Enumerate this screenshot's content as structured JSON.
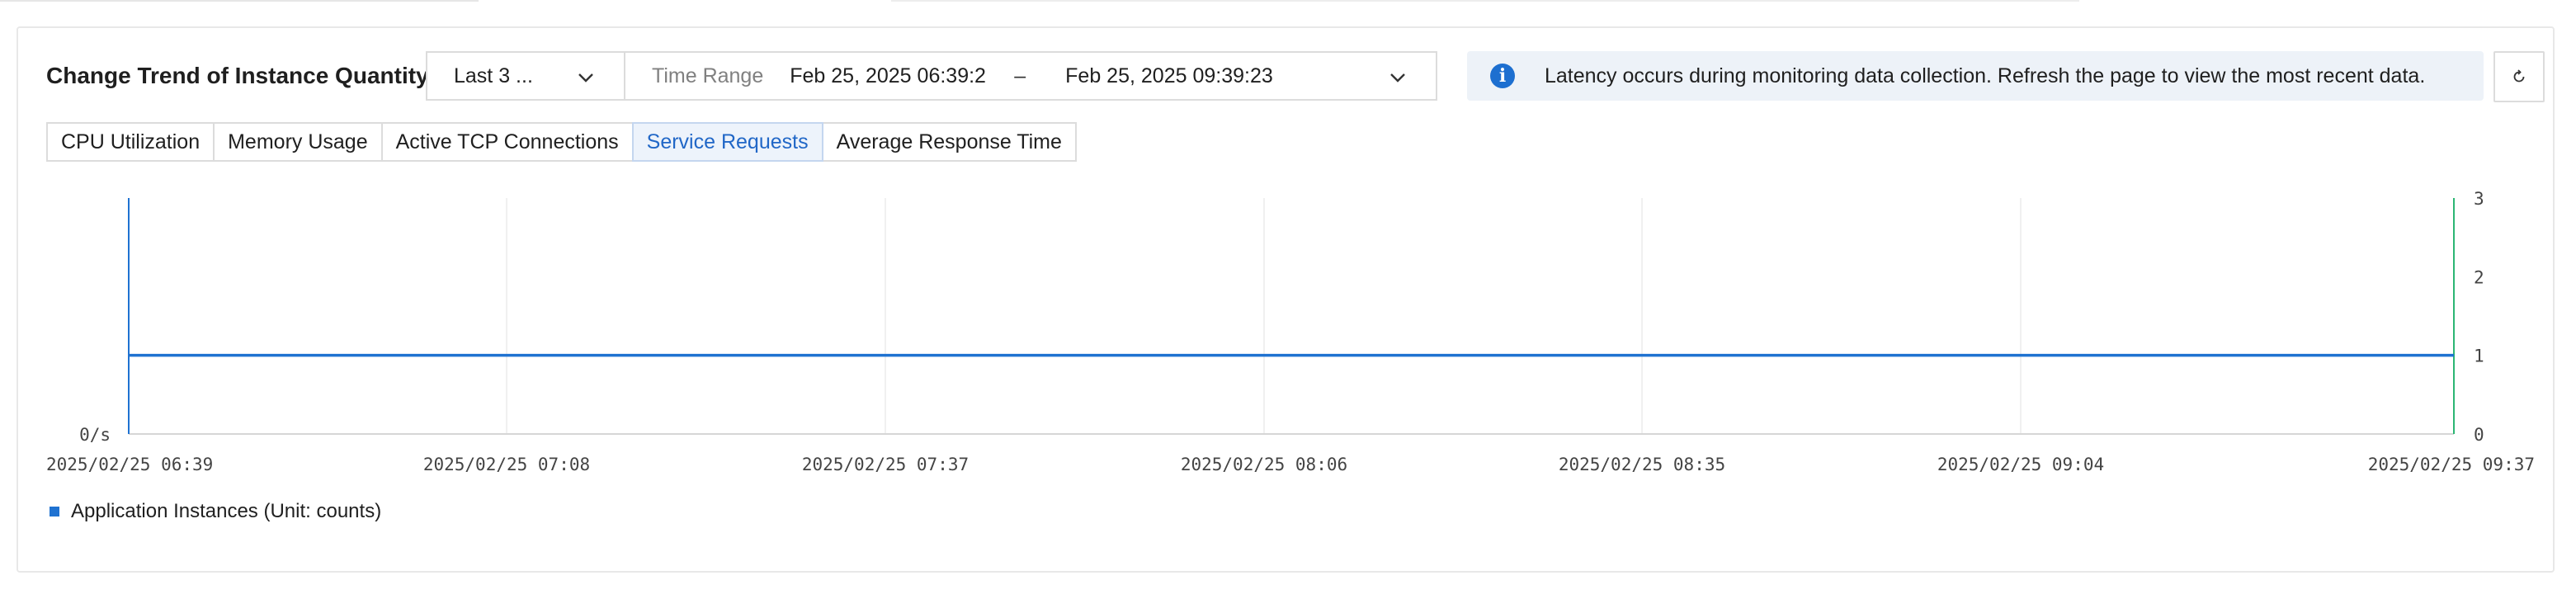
{
  "card": {
    "title": "Change Trend of Instance Quantity"
  },
  "picker": {
    "preset_label": "Last 3 ...",
    "range_label": "Time Range",
    "start": "Feb 25, 2025 06:39:2",
    "separator": "–",
    "end": "Feb 25, 2025 09:39:23"
  },
  "notice": {
    "message": "Latency occurs during monitoring data collection. Refresh the page to view the most recent data."
  },
  "tabs": [
    {
      "label": "CPU Utilization",
      "active": false
    },
    {
      "label": "Memory Usage",
      "active": false
    },
    {
      "label": "Active TCP Connections",
      "active": false
    },
    {
      "label": "Service Requests",
      "active": true
    },
    {
      "label": "Average Response Time",
      "active": false
    }
  ],
  "chart_data": {
    "type": "line",
    "x": [
      "2025/02/25 06:39",
      "2025/02/25 07:08",
      "2025/02/25 07:37",
      "2025/02/25 08:06",
      "2025/02/25 08:35",
      "2025/02/25 09:04",
      "2025/02/25 09:37"
    ],
    "x_tick_labels": [
      "2025/02/25 06:39",
      "2025/02/25 07:08",
      "2025/02/25 07:37",
      "2025/02/25 08:06",
      "2025/02/25 08:35",
      "2025/02/25 09:04",
      "2025/02/25 09:37"
    ],
    "left_axis": {
      "tick_labels": [
        "0/s"
      ],
      "color": "#1f72d1"
    },
    "right_axis": {
      "tick_labels": [
        "0",
        "1",
        "2",
        "3"
      ],
      "ylim": [
        0,
        3
      ],
      "color": "#2bb673"
    },
    "series": [
      {
        "name": "Application Instances (Unit: counts)",
        "axis": "right",
        "values": [
          1,
          1,
          1,
          1,
          1,
          1,
          1
        ],
        "color": "#1f72d1"
      }
    ],
    "grid": "vertical",
    "legend": "bottom-left"
  },
  "colors": {
    "accent": "#1f72d1",
    "tab_active_text": "#2167c7",
    "right_axis": "#2bb673"
  }
}
